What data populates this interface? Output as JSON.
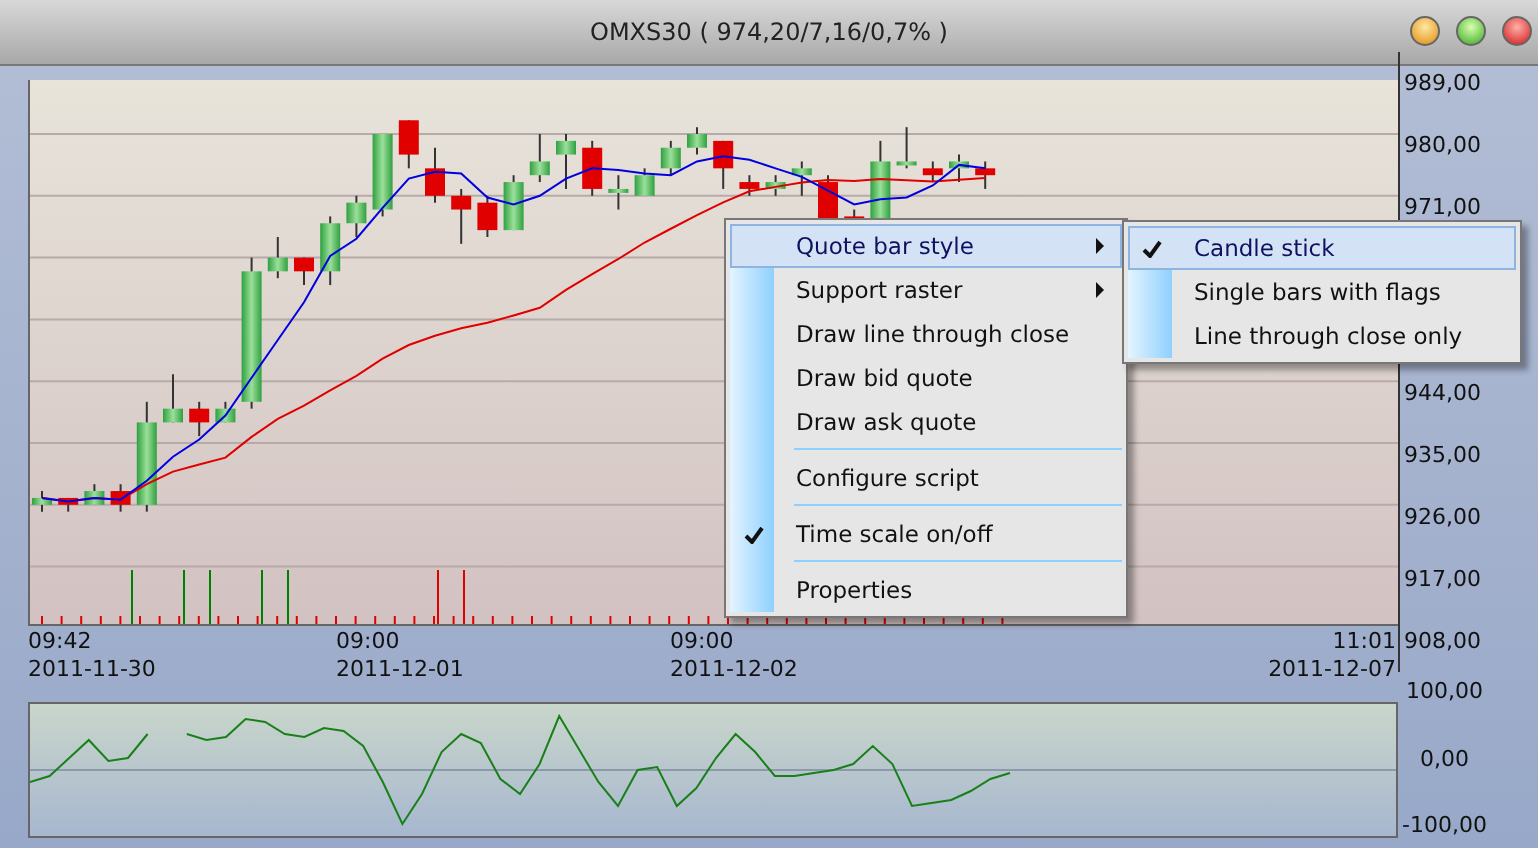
{
  "window": {
    "title": "OMXS30 ( 974,20/7,16/0,7% )"
  },
  "price_chart": {
    "y_axis_labels": [
      "989,00",
      "980,00",
      "971,00",
      "944,00",
      "935,00",
      "926,00",
      "917,00",
      "908,00"
    ],
    "time_labels": [
      {
        "time": "09:42",
        "date": "2011-11-30"
      },
      {
        "time": "09:00",
        "date": "2011-12-01"
      },
      {
        "time": "09:00",
        "date": "2011-12-02"
      },
      {
        "time": "11:01",
        "date": "2011-12-07"
      }
    ]
  },
  "oscillator": {
    "y_axis_labels": [
      "100,00",
      "0,00",
      "-100,00"
    ]
  },
  "context_menu": {
    "items": [
      {
        "kind": "item",
        "label": "Quote bar style",
        "checked": false,
        "submenu": true,
        "selected": true
      },
      {
        "kind": "item",
        "label": "Support raster",
        "checked": false,
        "submenu": true,
        "selected": false
      },
      {
        "kind": "item",
        "label": "Draw line through close",
        "checked": false,
        "submenu": false,
        "selected": false
      },
      {
        "kind": "item",
        "label": "Draw bid quote",
        "checked": false,
        "submenu": false,
        "selected": false
      },
      {
        "kind": "item",
        "label": "Draw ask quote",
        "checked": false,
        "submenu": false,
        "selected": false
      },
      {
        "kind": "separator"
      },
      {
        "kind": "item",
        "label": "Configure script",
        "checked": false,
        "submenu": false,
        "selected": false
      },
      {
        "kind": "separator"
      },
      {
        "kind": "item",
        "label": "Time scale on/off",
        "checked": true,
        "submenu": false,
        "selected": false
      },
      {
        "kind": "separator"
      },
      {
        "kind": "item",
        "label": "Properties",
        "checked": false,
        "submenu": false,
        "selected": false
      }
    ]
  },
  "submenu": {
    "items": [
      {
        "label": "Candle stick",
        "checked": true,
        "selected": true
      },
      {
        "label": "Single bars with flags",
        "checked": false,
        "selected": false
      },
      {
        "label": "Line through close only",
        "checked": false,
        "selected": false
      }
    ]
  }
}
